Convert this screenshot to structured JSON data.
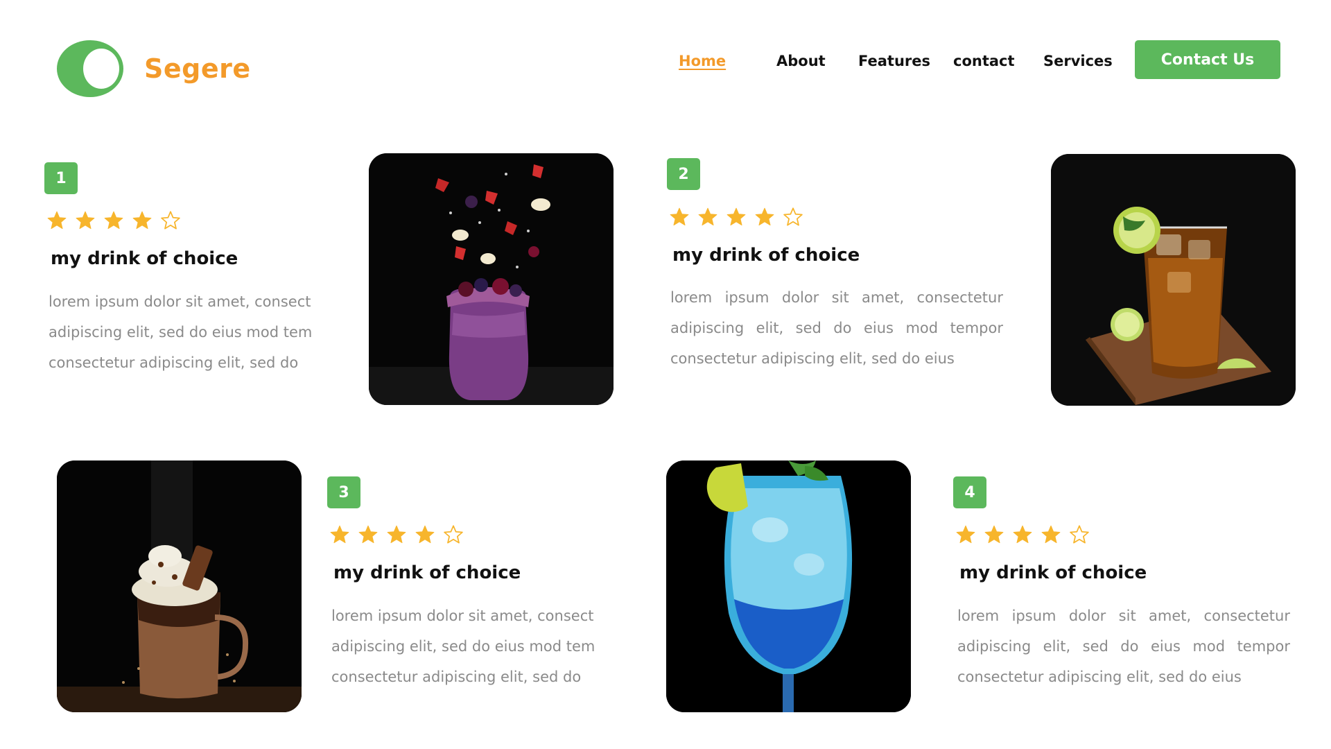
{
  "header": {
    "brand": "Segere",
    "nav": [
      {
        "label": "Home",
        "active": true
      },
      {
        "label": "About",
        "active": false
      },
      {
        "label": "Features",
        "active": false
      },
      {
        "label": "contact",
        "active": false
      },
      {
        "label": "Services",
        "active": false
      }
    ],
    "cta_label": "Contact Us"
  },
  "cards": [
    {
      "number": "1",
      "rating": 4,
      "max_rating": 5,
      "title": "my drink of choice",
      "description": "lorem ipsum dolor sit amet, consect adipiscing elit, sed do eius mod tem consectetur adipiscing elit, sed do",
      "image": "berry-smoothie-jar"
    },
    {
      "number": "2",
      "rating": 4,
      "max_rating": 5,
      "title": "my drink of choice",
      "description": "lorem ipsum dolor sit amet, consectetur adipiscing elit, sed do eius mod tempor consectetur adipiscing elit, sed do eius",
      "image": "iced-tea-glass"
    },
    {
      "number": "3",
      "rating": 4,
      "max_rating": 5,
      "title": "my drink of choice",
      "description": "lorem ipsum dolor sit amet, consect adipiscing elit, sed do eius mod tem consectetur adipiscing elit, sed do",
      "image": "chocolate-milkshake"
    },
    {
      "number": "4",
      "rating": 4,
      "max_rating": 5,
      "title": "my drink of choice",
      "description": "lorem ipsum dolor sit amet, consectetur adipiscing elit, sed do eius mod tempor consectetur adipiscing elit, sed do eius",
      "image": "blue-lagoon-cocktail"
    }
  ],
  "colors": {
    "accent": "#5cb85c",
    "brand": "#f39a2a",
    "star": "#f7b52c"
  }
}
